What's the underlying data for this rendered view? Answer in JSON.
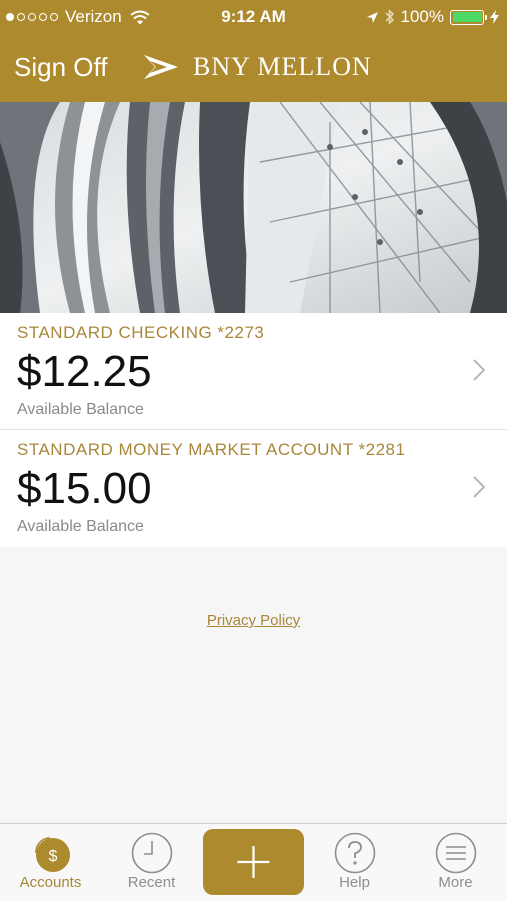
{
  "status_bar": {
    "carrier": "Verizon",
    "time": "9:12 AM",
    "battery": "100%"
  },
  "nav": {
    "sign_off": "Sign Off",
    "brand": "BNY MELLON"
  },
  "accounts": [
    {
      "name": "STANDARD CHECKING *2273",
      "balance": "$12.25",
      "label": "Available Balance"
    },
    {
      "name": "STANDARD MONEY MARKET ACCOUNT *2281",
      "balance": "$15.00",
      "label": "Available Balance"
    }
  ],
  "privacy_policy": "Privacy Policy",
  "tabs": {
    "accounts": "Accounts",
    "accounts_icon_text": "$",
    "recent": "Recent",
    "help": "Help",
    "more": "More"
  },
  "colors": {
    "brand_gold": "#ad8a2e",
    "battery_green": "#4cd964"
  }
}
